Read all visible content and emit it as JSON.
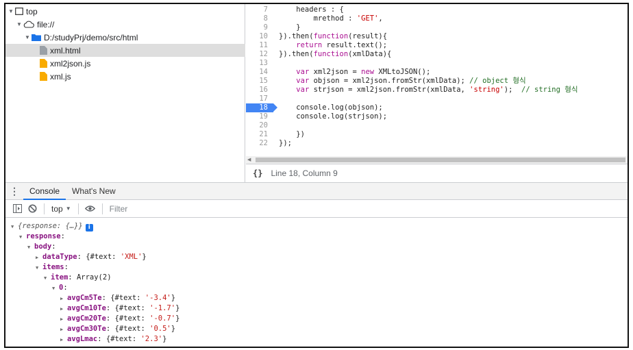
{
  "tree": {
    "items": [
      {
        "label": "top",
        "level": 0,
        "expanded": true,
        "icon": "frame-icon"
      },
      {
        "label": "file://",
        "level": 1,
        "expanded": true,
        "icon": "cloud-icon"
      },
      {
        "label": "D:/studyPrj/demo/src/html",
        "level": 2,
        "expanded": true,
        "icon": "folder-icon"
      },
      {
        "label": "xml.html",
        "level": 3,
        "selected": true,
        "icon": "file-icon-gray"
      },
      {
        "label": "xml2json.js",
        "level": 3,
        "icon": "file-icon-yellow"
      },
      {
        "label": "xml.js",
        "level": 3,
        "icon": "file-icon-yellow"
      }
    ]
  },
  "editor": {
    "breakpoint_line": "18",
    "lines": [
      {
        "n": "7",
        "code": [
          {
            "t": "    headers : {",
            "c": ""
          }
        ]
      },
      {
        "n": "8",
        "code": [
          {
            "t": "        mrethod : ",
            "c": ""
          },
          {
            "t": "'GET'",
            "c": "str"
          },
          {
            "t": ",",
            "c": ""
          }
        ]
      },
      {
        "n": "9",
        "code": [
          {
            "t": "    }",
            "c": ""
          }
        ]
      },
      {
        "n": "10",
        "code": [
          {
            "t": "}).then(",
            "c": ""
          },
          {
            "t": "function",
            "c": "kw"
          },
          {
            "t": "(result){",
            "c": ""
          }
        ]
      },
      {
        "n": "11",
        "code": [
          {
            "t": "    ",
            "c": ""
          },
          {
            "t": "return",
            "c": "kw"
          },
          {
            "t": " result.text();",
            "c": ""
          }
        ]
      },
      {
        "n": "12",
        "code": [
          {
            "t": "}).then(",
            "c": ""
          },
          {
            "t": "function",
            "c": "kw"
          },
          {
            "t": "(xmlData){",
            "c": ""
          }
        ]
      },
      {
        "n": "13",
        "code": [
          {
            "t": "",
            "c": ""
          }
        ]
      },
      {
        "n": "14",
        "code": [
          {
            "t": "    ",
            "c": ""
          },
          {
            "t": "var",
            "c": "kw"
          },
          {
            "t": " xml2json = ",
            "c": ""
          },
          {
            "t": "new",
            "c": "kw"
          },
          {
            "t": " XMLtoJSON();",
            "c": ""
          }
        ]
      },
      {
        "n": "15",
        "code": [
          {
            "t": "    ",
            "c": ""
          },
          {
            "t": "var",
            "c": "kw"
          },
          {
            "t": " objson = xml2json.fromStr(xmlData); ",
            "c": ""
          },
          {
            "t": "// object 형식",
            "c": "cm"
          }
        ]
      },
      {
        "n": "16",
        "code": [
          {
            "t": "    ",
            "c": ""
          },
          {
            "t": "var",
            "c": "kw"
          },
          {
            "t": " strjson = xml2json.fromStr(xmlData, ",
            "c": ""
          },
          {
            "t": "'string'",
            "c": "str"
          },
          {
            "t": ");  ",
            "c": ""
          },
          {
            "t": "// string 형식",
            "c": "cm"
          }
        ]
      },
      {
        "n": "17",
        "code": [
          {
            "t": "",
            "c": ""
          }
        ]
      },
      {
        "n": "18",
        "code": [
          {
            "t": "    console.",
            "c": ""
          },
          {
            "t": "log(objson);",
            "c": ""
          }
        ]
      },
      {
        "n": "19",
        "code": [
          {
            "t": "    console.log(strjson);",
            "c": ""
          }
        ]
      },
      {
        "n": "20",
        "code": [
          {
            "t": "",
            "c": ""
          }
        ]
      },
      {
        "n": "21",
        "code": [
          {
            "t": "    })",
            "c": ""
          }
        ]
      },
      {
        "n": "22",
        "code": [
          {
            "t": "});",
            "c": ""
          }
        ]
      }
    ],
    "status_icon": "{}",
    "status_text": "Line 18, Column 9"
  },
  "drawer": {
    "tabs": [
      {
        "label": "Console",
        "active": true
      },
      {
        "label": "What's New",
        "active": false
      }
    ]
  },
  "toolbar": {
    "context": "top",
    "filter_placeholder": "Filter"
  },
  "console": {
    "rows": [
      {
        "indent": 0,
        "tri": "▼",
        "parts": [
          {
            "t": "{response: {…}}",
            "c": "ital"
          }
        ],
        "info": true
      },
      {
        "indent": 1,
        "tri": "▼",
        "parts": [
          {
            "t": "response",
            "c": "key"
          },
          {
            "t": ":",
            "c": ""
          }
        ]
      },
      {
        "indent": 2,
        "tri": "▼",
        "parts": [
          {
            "t": "body",
            "c": "key"
          },
          {
            "t": ":",
            "c": ""
          }
        ]
      },
      {
        "indent": 3,
        "tri": "▶",
        "parts": [
          {
            "t": "dataType",
            "c": "key"
          },
          {
            "t": ": {#text: ",
            "c": ""
          },
          {
            "t": "'XML'",
            "c": "sv"
          },
          {
            "t": "}",
            "c": ""
          }
        ]
      },
      {
        "indent": 3,
        "tri": "▼",
        "parts": [
          {
            "t": "items",
            "c": "key"
          },
          {
            "t": ":",
            "c": ""
          }
        ]
      },
      {
        "indent": 4,
        "tri": "▼",
        "parts": [
          {
            "t": "item",
            "c": "key"
          },
          {
            "t": ": Array(2)",
            "c": ""
          }
        ]
      },
      {
        "indent": 5,
        "tri": "▼",
        "parts": [
          {
            "t": "0",
            "c": "key"
          },
          {
            "t": ":",
            "c": ""
          }
        ]
      },
      {
        "indent": 6,
        "tri": "▶",
        "parts": [
          {
            "t": "avgCm5Te",
            "c": "key"
          },
          {
            "t": ": {#text: ",
            "c": ""
          },
          {
            "t": "'-3.4'",
            "c": "sv"
          },
          {
            "t": "}",
            "c": ""
          }
        ]
      },
      {
        "indent": 6,
        "tri": "▶",
        "parts": [
          {
            "t": "avgCm10Te",
            "c": "key"
          },
          {
            "t": ": {#text: ",
            "c": ""
          },
          {
            "t": "'-1.7'",
            "c": "sv"
          },
          {
            "t": "}",
            "c": ""
          }
        ]
      },
      {
        "indent": 6,
        "tri": "▶",
        "parts": [
          {
            "t": "avgCm20Te",
            "c": "key"
          },
          {
            "t": ": {#text: ",
            "c": ""
          },
          {
            "t": "'-0.7'",
            "c": "sv"
          },
          {
            "t": "}",
            "c": ""
          }
        ]
      },
      {
        "indent": 6,
        "tri": "▶",
        "parts": [
          {
            "t": "avgCm30Te",
            "c": "key"
          },
          {
            "t": ": {#text: ",
            "c": ""
          },
          {
            "t": "'0.5'",
            "c": "sv"
          },
          {
            "t": "}",
            "c": ""
          }
        ]
      },
      {
        "indent": 6,
        "tri": "▶",
        "parts": [
          {
            "t": "avgLmac",
            "c": "key"
          },
          {
            "t": ": {#text: ",
            "c": ""
          },
          {
            "t": "'2.3'",
            "c": "sv"
          },
          {
            "t": "}",
            "c": ""
          }
        ]
      }
    ]
  },
  "colors": {
    "accent": "#1a73e8",
    "breakpoint": "#4285f4",
    "selection": "#dedede"
  }
}
